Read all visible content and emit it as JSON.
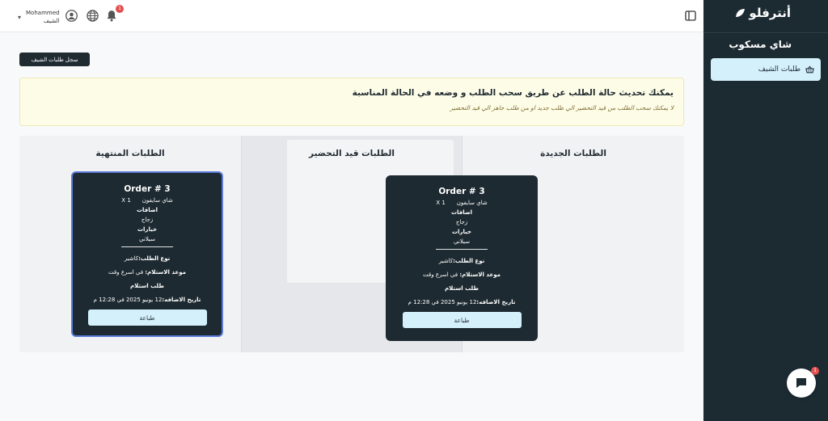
{
  "header": {
    "user_name": "Mohammed",
    "user_role": "الشيف",
    "notification_count": "1"
  },
  "sidebar": {
    "logo": "أنترفلو",
    "org_name": "شاي مسكوب",
    "items": [
      {
        "label": "طلبات الشيف",
        "icon": "basket-icon",
        "active": true
      }
    ]
  },
  "main": {
    "history_button": "سجل طلبات الشيف",
    "notice": {
      "title": "يمكنك تحديث حالة الطلب عن طريق سحب الطلب و وضعه في الحالة المناسبة",
      "subtitle": "لا يمكنك سحب الطلب من قيد التحضير الي طلب جديد او من طلب جاهز الي قيد التحضير"
    },
    "columns": [
      {
        "title": "الطلبات الجديدة"
      },
      {
        "title": "الطلبات قيد التحضير"
      },
      {
        "title": "الطلبات المنتهية"
      }
    ],
    "cards": [
      {
        "title": "Order # 3",
        "item_name": "شاي سايفون",
        "item_qty": "1 X",
        "addons_label": "اضافات",
        "addon": "زجاج",
        "options_label": "خيارات",
        "option": "سيلاني",
        "type_label": "نوع الطلب:",
        "type_value": "كاشير",
        "pickup_label": "موعد الاستلام:",
        "pickup_value": "في اسرع وقت",
        "request": "طلب استلام",
        "date_label": "تاريخ الاضافه:",
        "date_value": "12 يونيو 2025 في 12:28 م",
        "print": "طباعة"
      },
      {
        "title": "Order # 3",
        "item_name": "شاي سايفون",
        "item_qty": "1 X",
        "addons_label": "اضافات",
        "addon": "زجاج",
        "options_label": "خيارات",
        "option": "سيلاني",
        "type_label": "نوع الطلب:",
        "type_value": "كاشير",
        "pickup_label": "موعد الاستلام:",
        "pickup_value": "في اسرع وقت",
        "request": "طلب استلام",
        "date_label": "تاريخ الاضافه:",
        "date_value": "12 يونيو 2025 في 12:28 م",
        "print": "طباعة"
      }
    ]
  },
  "chat": {
    "badge": "1"
  },
  "colors": {
    "sidebar": "#1c2a32",
    "accent": "#d4f1fb",
    "card": "#1d2a31",
    "notice_bg": "#fdfce6",
    "badge": "#e05050"
  }
}
